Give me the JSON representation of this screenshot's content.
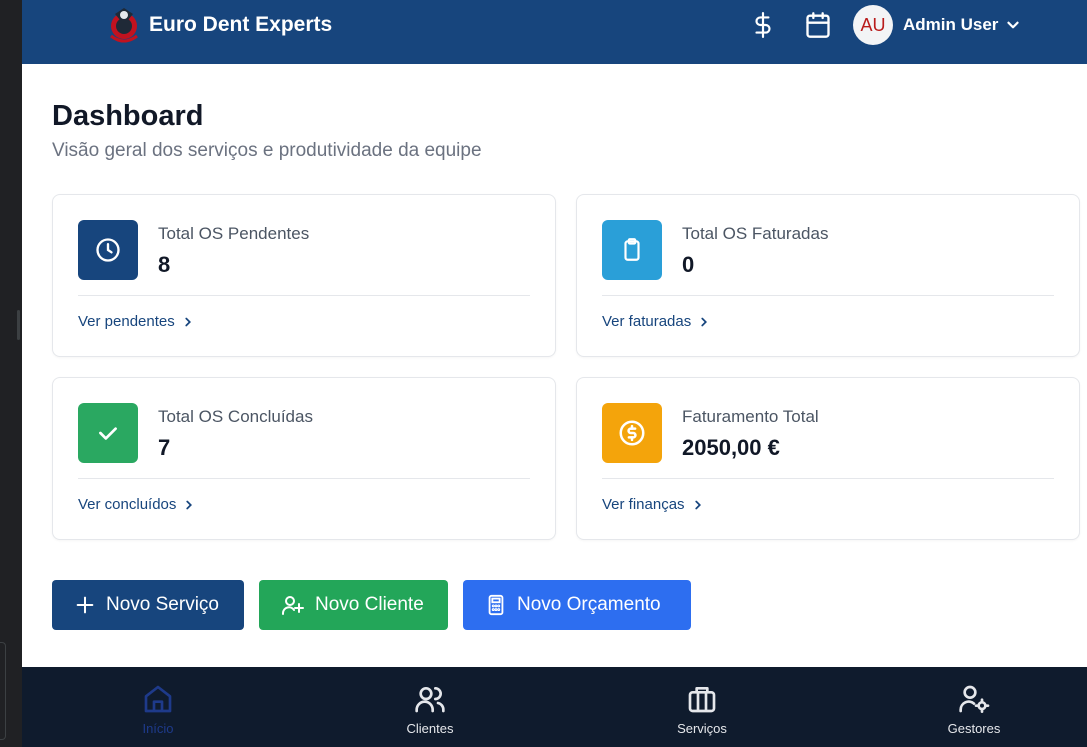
{
  "header": {
    "brand": "Euro Dent Experts",
    "icons": [
      "dollar-icon",
      "calendar-icon"
    ],
    "avatar_initials": "AU",
    "user_name": "Admin User"
  },
  "page": {
    "title": "Dashboard",
    "subtitle": "Visão geral dos serviços e produtividade da equipe"
  },
  "cards": [
    {
      "label": "Total OS Pendentes",
      "value": "8",
      "link": "Ver pendentes",
      "icon": "clock-icon",
      "color": "#17457d"
    },
    {
      "label": "Total OS Faturadas",
      "value": "0",
      "link": "Ver faturadas",
      "icon": "clipboard-icon",
      "color": "#2a9fd8"
    },
    {
      "label": "Total OS Concluídas",
      "value": "7",
      "link": "Ver concluídos",
      "icon": "check-icon",
      "color": "#2aa861"
    },
    {
      "label": "Faturamento Total",
      "value": "2050,00 €",
      "link": "Ver finanças",
      "icon": "coin-icon",
      "color": "#f4a40b"
    }
  ],
  "actions": {
    "new_service": "Novo Serviço",
    "new_client": "Novo Cliente",
    "new_quote": "Novo Orçamento"
  },
  "nav": [
    {
      "label": "Início",
      "icon": "home-icon",
      "active": true
    },
    {
      "label": "Clientes",
      "icon": "users-icon",
      "active": false
    },
    {
      "label": "Serviços",
      "icon": "briefcase-icon",
      "active": false
    },
    {
      "label": "Gestores",
      "icon": "user-settings-icon",
      "active": false
    }
  ],
  "colors": {
    "header_bg": "#17457d",
    "btn_service": "#17457d",
    "btn_client": "#23a659",
    "btn_quote": "#2d6ef0",
    "nav_bg": "#0f1b2d",
    "nav_active": "#1e3a8a"
  }
}
